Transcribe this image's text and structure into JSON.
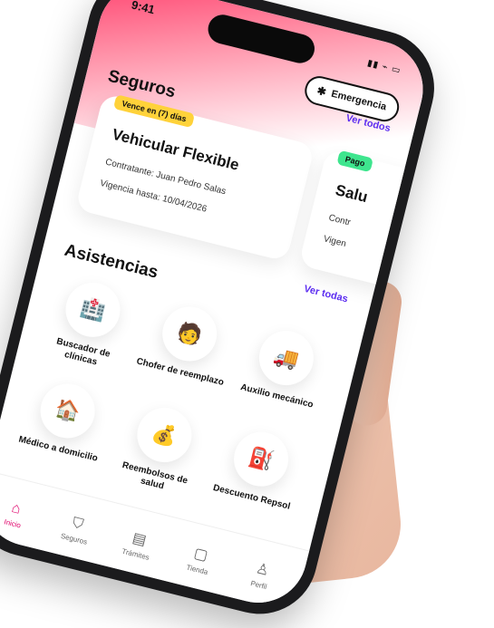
{
  "status_bar": {
    "time": "9:41",
    "icons": "▮▮ ⌁ ▭"
  },
  "emergency": {
    "label": "Emergencia",
    "icon": "alert-icon"
  },
  "seguros": {
    "title": "Seguros",
    "see_all": "Ver todos",
    "cards": [
      {
        "badge": "Vence en (7) días",
        "badge_color": "#ffd23a",
        "title": "Vehicular Flexible",
        "line1": "Contratante: Juan Pedro Salas",
        "line2": "Vigencia hasta: 10/04/2026"
      },
      {
        "badge": "Pago",
        "badge_color": "#3ee58e",
        "title": "Salu",
        "line1": "Contr",
        "line2": "Vigen"
      }
    ]
  },
  "asistencias": {
    "title": "Asistencias",
    "see_all": "Ver todas",
    "items": [
      {
        "label": "Buscador de clínicas",
        "icon": "clinic-search-icon",
        "glyph": "🏥"
      },
      {
        "label": "Chofer de reemplazo",
        "icon": "driver-icon",
        "glyph": "🧑"
      },
      {
        "label": "Auxilio mecánico",
        "icon": "tow-truck-icon",
        "glyph": "🚚"
      },
      {
        "label": "Médico a domicilio",
        "icon": "house-doctor-icon",
        "glyph": "🏠"
      },
      {
        "label": "Reembolsos de salud",
        "icon": "money-bag-icon",
        "glyph": "💰"
      },
      {
        "label": "Descuento Repsol",
        "icon": "fuel-coupon-icon",
        "glyph": "⛽"
      }
    ]
  },
  "tabbar": {
    "active_color": "#e0006a",
    "tabs": [
      {
        "label": "Inicio",
        "icon": "home-icon",
        "glyph": "⌂"
      },
      {
        "label": "Seguros",
        "icon": "shield-icon",
        "glyph": "⛉"
      },
      {
        "label": "Trámites",
        "icon": "document-icon",
        "glyph": "▤"
      },
      {
        "label": "Tienda",
        "icon": "bag-icon",
        "glyph": "▢"
      },
      {
        "label": "Perfil",
        "icon": "user-icon",
        "glyph": "♙"
      }
    ]
  }
}
